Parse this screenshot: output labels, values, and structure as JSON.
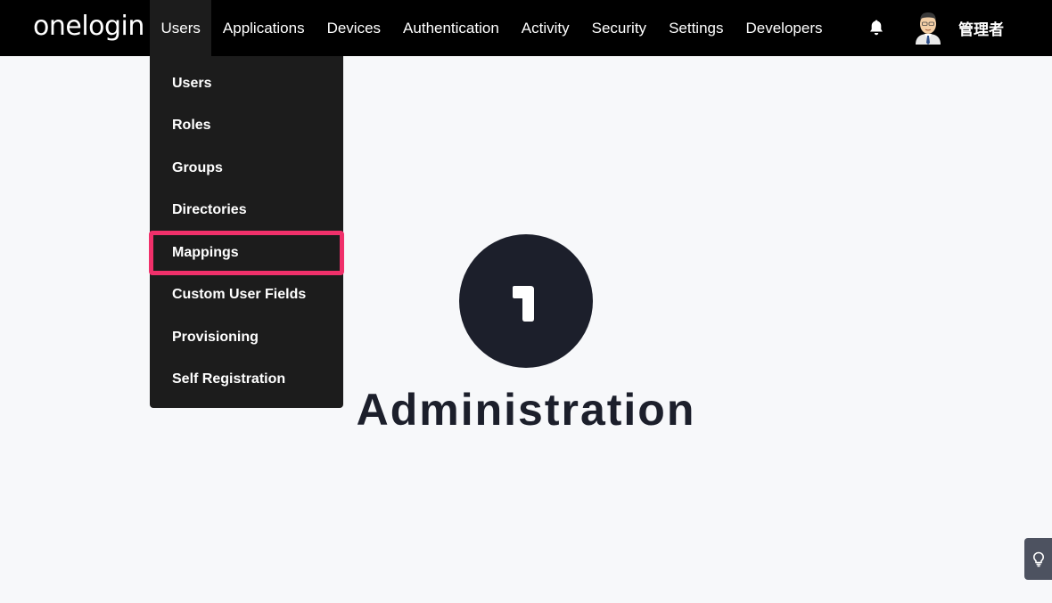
{
  "brand": {
    "logo_text": "onelogin"
  },
  "nav": {
    "items": [
      {
        "label": "Users",
        "active": true
      },
      {
        "label": "Applications"
      },
      {
        "label": "Devices"
      },
      {
        "label": "Authentication"
      },
      {
        "label": "Activity"
      },
      {
        "label": "Security"
      },
      {
        "label": "Settings"
      },
      {
        "label": "Developers"
      }
    ]
  },
  "header": {
    "notifications_icon": "bell-icon",
    "user_name": "管理者"
  },
  "users_menu": {
    "items": [
      {
        "label": "Users"
      },
      {
        "label": "Roles"
      },
      {
        "label": "Groups"
      },
      {
        "label": "Directories"
      },
      {
        "label": "Mappings",
        "highlighted": true
      },
      {
        "label": "Custom User Fields"
      },
      {
        "label": "Provisioning"
      },
      {
        "label": "Self Registration"
      }
    ]
  },
  "hero": {
    "badge_text": "1",
    "title": "Administration"
  },
  "colors": {
    "topbar": "#000000",
    "menu_bg": "#1c1c1c",
    "highlight": "#f0306a",
    "hero_dark": "#1c1f2b",
    "page_bg": "#f7f8fa"
  },
  "help_tab_icon": "lightbulb-icon"
}
